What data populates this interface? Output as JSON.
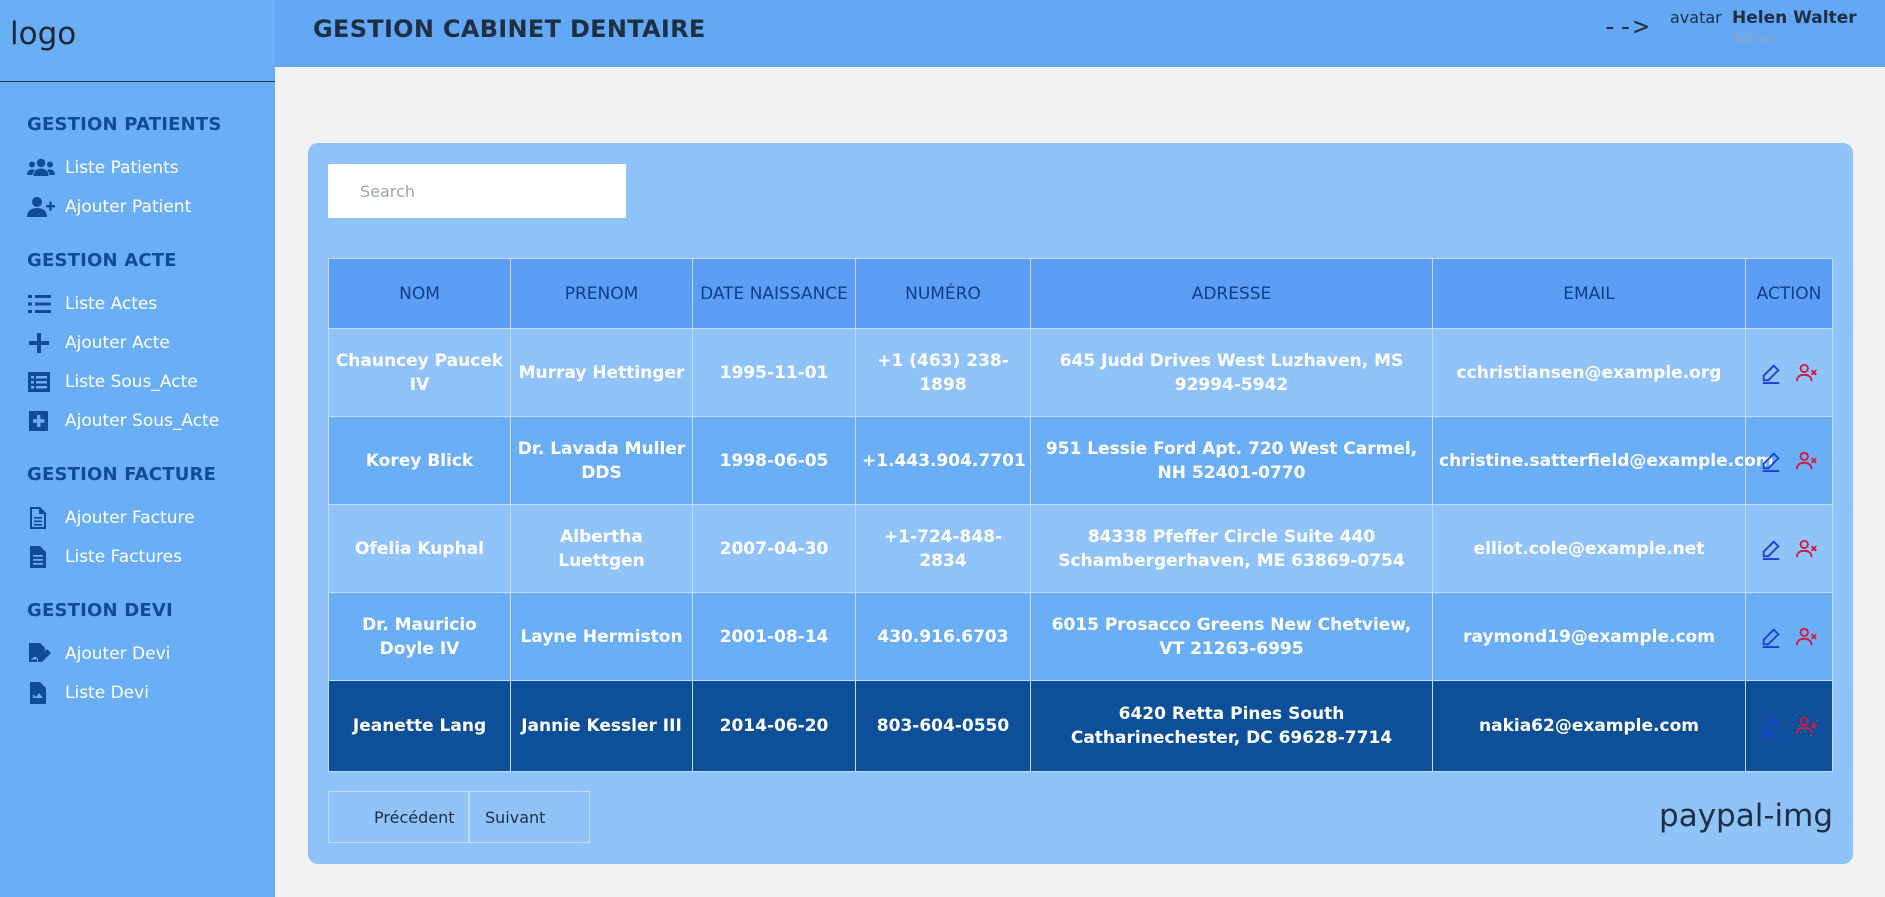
{
  "sidebar": {
    "logo": "logo",
    "sections": [
      {
        "title": "GESTION PATIENTS",
        "items": [
          {
            "label": "Liste Patients",
            "icon": "users-icon"
          },
          {
            "label": "Ajouter Patient",
            "icon": "user-plus-icon"
          }
        ]
      },
      {
        "title": "GESTION ACTE",
        "items": [
          {
            "label": "Liste Actes",
            "icon": "list-icon"
          },
          {
            "label": "Ajouter Acte",
            "icon": "plus-icon"
          },
          {
            "label": "Liste Sous_Acte",
            "icon": "list-alt-icon"
          },
          {
            "label": "Ajouter Sous_Acte",
            "icon": "plus-square-icon"
          }
        ]
      },
      {
        "title": "GESTION FACTURE",
        "items": [
          {
            "label": "Ajouter Facture",
            "icon": "file-icon"
          },
          {
            "label": "Liste Factures",
            "icon": "file-text-icon"
          }
        ]
      },
      {
        "title": "GESTION DEVI",
        "items": [
          {
            "label": "Ajouter Devi",
            "icon": "file-signature-icon"
          },
          {
            "label": "Liste Devi",
            "icon": "file-invoice-icon"
          }
        ]
      }
    ]
  },
  "header": {
    "title": "GESTION CABINET DENTAIRE",
    "arrow": "-->",
    "avatar": "avatar",
    "user_name": "Helen Walter",
    "user_role": "Admin"
  },
  "search": {
    "placeholder": "Search"
  },
  "table": {
    "headers": [
      "NOM",
      "PRENOM",
      "DATE NAISSANCE",
      "NUMÉRO",
      "ADRESSE",
      "EMAIL",
      "ACTION"
    ],
    "rows": [
      [
        "Chauncey Paucek IV",
        "Murray Hettinger",
        "1995-11-01",
        "+1 (463) 238-1898",
        "645 Judd Drives West Luzhaven, MS 92994-5942",
        "cchristiansen@example.org"
      ],
      [
        "Korey Blick",
        "Dr. Lavada Muller DDS",
        "1998-06-05",
        "+1.443.904.7701",
        "951 Lessie Ford Apt. 720 West Carmel, NH 52401-0770",
        "christine.satterfield@example.com"
      ],
      [
        "Ofelia Kuphal",
        "Albertha Luettgen",
        "2007-04-30",
        "+1-724-848-2834",
        "84338 Pfeffer Circle Suite 440 Schambergerhaven, ME 63869-0754",
        "elliot.cole@example.net"
      ],
      [
        "Dr. Mauricio Doyle IV",
        "Layne Hermiston",
        "2001-08-14",
        "430.916.6703",
        "6015 Prosacco Greens New Chetview, VT 21263-6995",
        "raymond19@example.com"
      ],
      [
        "Jeanette Lang",
        "Jannie Kessler III",
        "2014-06-20",
        "803-604-0550",
        "6420 Retta Pines South Catharinechester, DC 69628-7714",
        "nakia62@example.com"
      ]
    ]
  },
  "pagination": {
    "prev": "Précédent",
    "next": "Suivant"
  },
  "paypal": "paypal-img",
  "colors": {
    "sidebar": "#6aaef5",
    "header": "#62a8f6",
    "card": "#90c3fa",
    "table_header": "#5c9df6",
    "selected_row": "#0d4f99",
    "edit_icon": "#1a3fd6",
    "delete_icon": "#d11a3a"
  }
}
